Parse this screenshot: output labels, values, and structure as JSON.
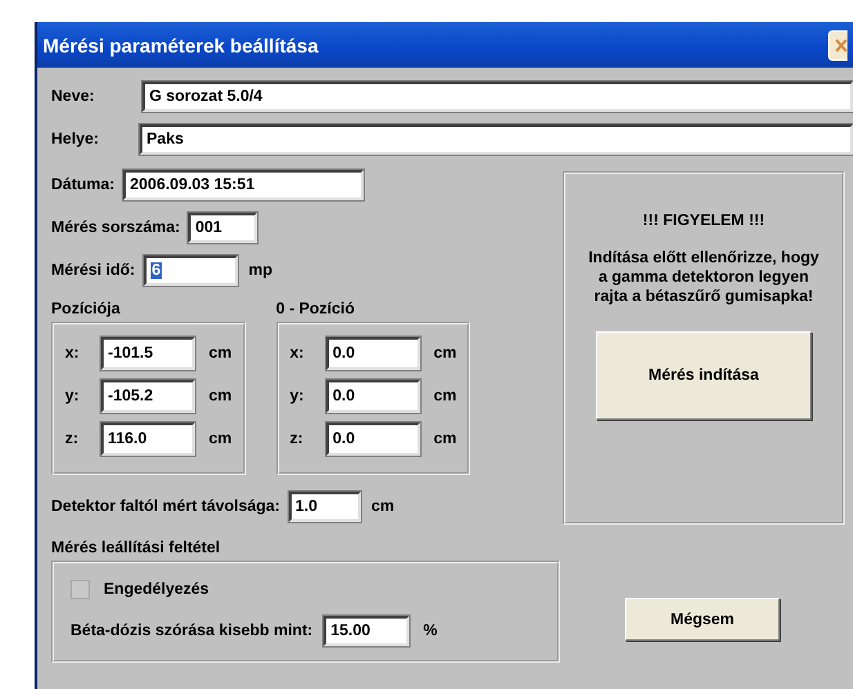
{
  "window": {
    "title": "Mérési paraméterek beállítása"
  },
  "fields": [
    {
      "label": "Neve:",
      "value": "G sorozat 5.0/4"
    },
    {
      "label": "Helye:",
      "value": "Paks"
    },
    {
      "label": "Dátuma:",
      "value": "2006.09.03 15:51"
    },
    {
      "label": "Mérés sorszáma:",
      "value": "001"
    },
    {
      "label": "Mérési idő:",
      "value": "6",
      "unit": "mp"
    }
  ],
  "position_groups": [
    {
      "title": "Pozíciója",
      "rows": [
        {
          "axis": "x:",
          "value": "-101.5",
          "unit": "cm"
        },
        {
          "axis": "y:",
          "value": "-105.2",
          "unit": "cm"
        },
        {
          "axis": "z:",
          "value": "116.0",
          "unit": "cm"
        }
      ]
    },
    {
      "title": "0 - Pozíció",
      "rows": [
        {
          "axis": "x:",
          "value": "0.0",
          "unit": "cm"
        },
        {
          "axis": "y:",
          "value": "0.0",
          "unit": "cm"
        },
        {
          "axis": "z:",
          "value": "0.0",
          "unit": "cm"
        }
      ]
    }
  ],
  "warning": {
    "title": "!!! FIGYELEM !!!",
    "text": "Indítása előtt ellenőrizze, hogy a gamma detektoron legyen rajta a bétaszűrő gumisapka!"
  },
  "start_button": "Mérés indítása",
  "distance": {
    "label": "Detektor faltól mért távolsága:",
    "value": "1.0",
    "unit": "cm"
  },
  "stop_condition": {
    "title": "Mérés leállítási feltétel",
    "checkbox": {
      "label": "Engedélyezés",
      "checked": false
    },
    "threshold": {
      "label": "Béta-dózis szórása kisebb mint:",
      "value": "15.00",
      "unit": "%"
    }
  },
  "cancel_button": "Mégsem"
}
